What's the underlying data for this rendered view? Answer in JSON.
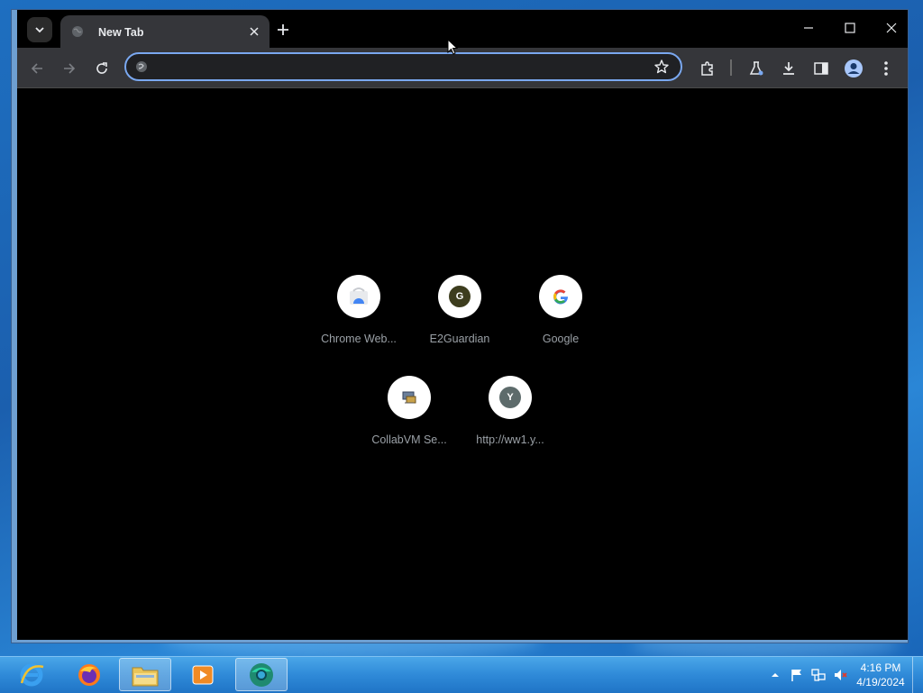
{
  "browser": {
    "tab": {
      "title": "New Tab"
    },
    "omnibox": {
      "value": "",
      "placeholder": ""
    },
    "accent": "#7aa8f0",
    "shortcuts": [
      {
        "label": "Chrome Web...",
        "icon": "chrome-web-store-icon"
      },
      {
        "label": "E2Guardian",
        "icon": "letter-g-icon",
        "letter": "G",
        "color": "#3d3d1e"
      },
      {
        "label": "Google",
        "icon": "google-g-icon"
      },
      {
        "label": "CollabVM Se...",
        "icon": "collabvm-icon"
      },
      {
        "label": "http://ww1.y...",
        "icon": "letter-y-icon",
        "letter": "Y",
        "color": "#5d6b6b"
      }
    ]
  },
  "taskbar": {
    "clock": {
      "time": "4:16 PM",
      "date": "4/19/2024"
    },
    "apps": [
      "internet-explorer-icon",
      "firefox-icon",
      "file-explorer-icon",
      "media-player-icon",
      "chrome-icon"
    ]
  }
}
